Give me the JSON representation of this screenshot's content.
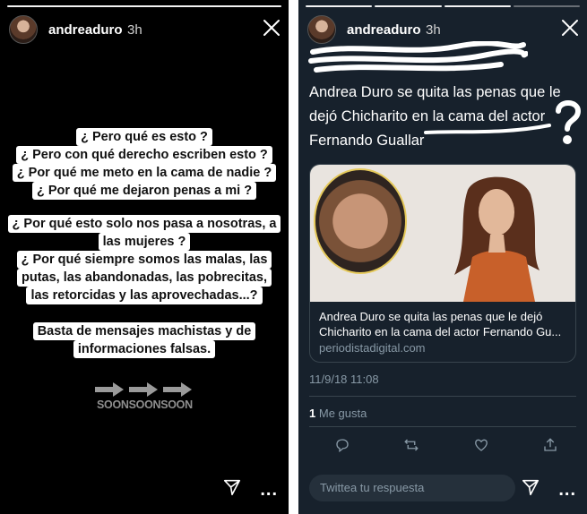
{
  "left_story": {
    "username": "andreaduro",
    "time": "3h",
    "icons": {
      "close": "close-icon",
      "send": "send-icon",
      "more": "more-icon",
      "arrow": "arrow-right-icon"
    },
    "block1": [
      "¿ Pero qué es esto ?",
      "¿ Pero con qué derecho escriben esto ?",
      "¿ Por qué me meto en la cama de nadie ?",
      "¿ Por qué me dejaron penas a mi ?"
    ],
    "block2": [
      "¿ Por qué esto solo nos pasa a nosotras, a",
      "las mujeres ?",
      "¿ Por qué siempre somos las malas, las",
      "putas, las abandonadas, las pobrecitas,",
      "las retorcidas y las aprovechadas...?"
    ],
    "block3": [
      "Basta de mensajes machistas y de",
      "informaciones falsas."
    ],
    "sticker_text": "SOONSOONSOON",
    "more_label": "..."
  },
  "right_story": {
    "username": "andreaduro",
    "time": "3h",
    "headline": "Andrea Duro se quita las penas que le dejó Chicharito en la cama del actor Fernando Guallar",
    "question_mark": "?",
    "card": {
      "title": "Andrea Duro se quita las penas que le dejó Chicharito en la cama del actor Fernando Gu...",
      "domain": "periodistadigital.com"
    },
    "date": "11/9/18 11:08",
    "likes_count": "1",
    "likes_label": "Me gusta",
    "reply_placeholder": "Twittea tu respuesta",
    "more_label": "...",
    "icons": [
      "reply-icon",
      "retweet-icon",
      "like-icon",
      "share-icon"
    ]
  },
  "colors": {
    "story_bg": "#000000",
    "twitter_bg": "#17212c",
    "accent": "#ffffff"
  }
}
